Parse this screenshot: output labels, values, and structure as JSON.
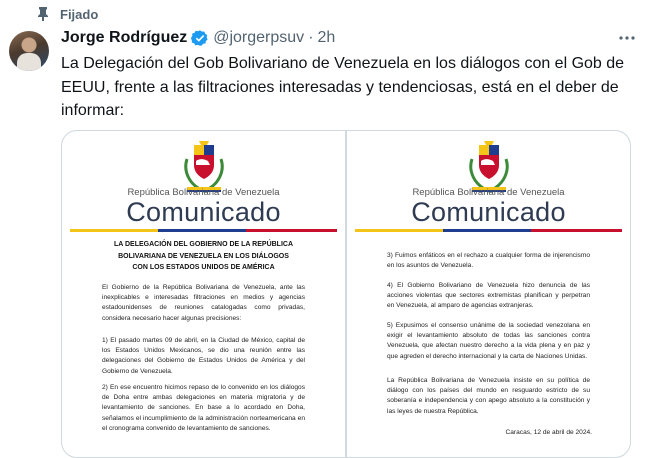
{
  "pinned": {
    "label": "Fijado",
    "icon": "pin-icon"
  },
  "author": {
    "name": "Jorge Rodríguez",
    "handle": "@jorgerpsuv",
    "separator": "·",
    "time": "2h",
    "verified_color": "#1d9bf0"
  },
  "tweet": {
    "text": "La Delegación del Gob Bolivariano de Venezuela en los diálogos con el Gob de EEUU, frente a las filtraciones interesadas y tendenciosas, está en el deber de informar:"
  },
  "colors": {
    "muted": "#536471",
    "flag_yellow": "#f4c518",
    "flag_blue": "#1f3d8f",
    "flag_red": "#c8102e",
    "comunicado": "#2f3b52"
  },
  "images": [
    {
      "republic": "República Bolivariana de Venezuela",
      "banner": "Comunicado",
      "title": "LA DELEGACIÓN DEL GOBIERNO DE LA REPÚBLICA BOLIVARIANA DE VENEZUELA EN LOS DIÁLOGOS CON LOS ESTADOS UNIDOS DE AMÉRICA",
      "paragraphs": [
        "El Gobierno de la República Bolivariana de Venezuela, ante las inexplicables e interesadas filtraciones en medios y agencias estadounidenses de reuniones catalogadas como privadas, considera necesario hacer algunas precisiones:",
        "1) El pasado martes 09 de abril, en la Ciudad de México, capital de los Estados Unidos Mexicanos, se dio una reunión entre las delegaciones del Gobierno de Estados Unidos de América y del Gobierno de Venezuela.",
        "2) En ese encuentro hicimos repaso de lo convenido en los diálogos de Doha entre ambas delegaciones en materia migratoria y de levantamiento de sanciones. En base a lo acordado en Doha, señalamos el incumplimiento de la administración norteamericana en el cronograma convenido de levantamiento de sanciones."
      ]
    },
    {
      "republic": "República Bolivariana de Venezuela",
      "banner": "Comunicado",
      "paragraphs": [
        "3) Fuimos enfáticos en el rechazo a cualquier forma de injerencismo en los asuntos de Venezuela.",
        "4) El Gobierno Bolivariano de Venezuela hizo denuncia de las acciones violentas que sectores extremistas planifican y perpetran en Venezuela, al amparo de agencias extranjeras.",
        "5) Expusimos el consenso unánime de la sociedad venezolana en exigir el levantamiento absoluto de todas las sanciones contra Venezuela, que afectan nuestro derecho a la vida plena y en paz y que agreden el derecho internacional y la carta de Naciones Unidas.",
        "La República Bolivariana de Venezuela insiste en su política de diálogo con los países del mundo en resguardo estricto de su soberanía e independencia y con apego absoluto a la constitución y las leyes de nuestra República."
      ],
      "signoff": "Caracas, 12 de abril de 2024."
    }
  ]
}
